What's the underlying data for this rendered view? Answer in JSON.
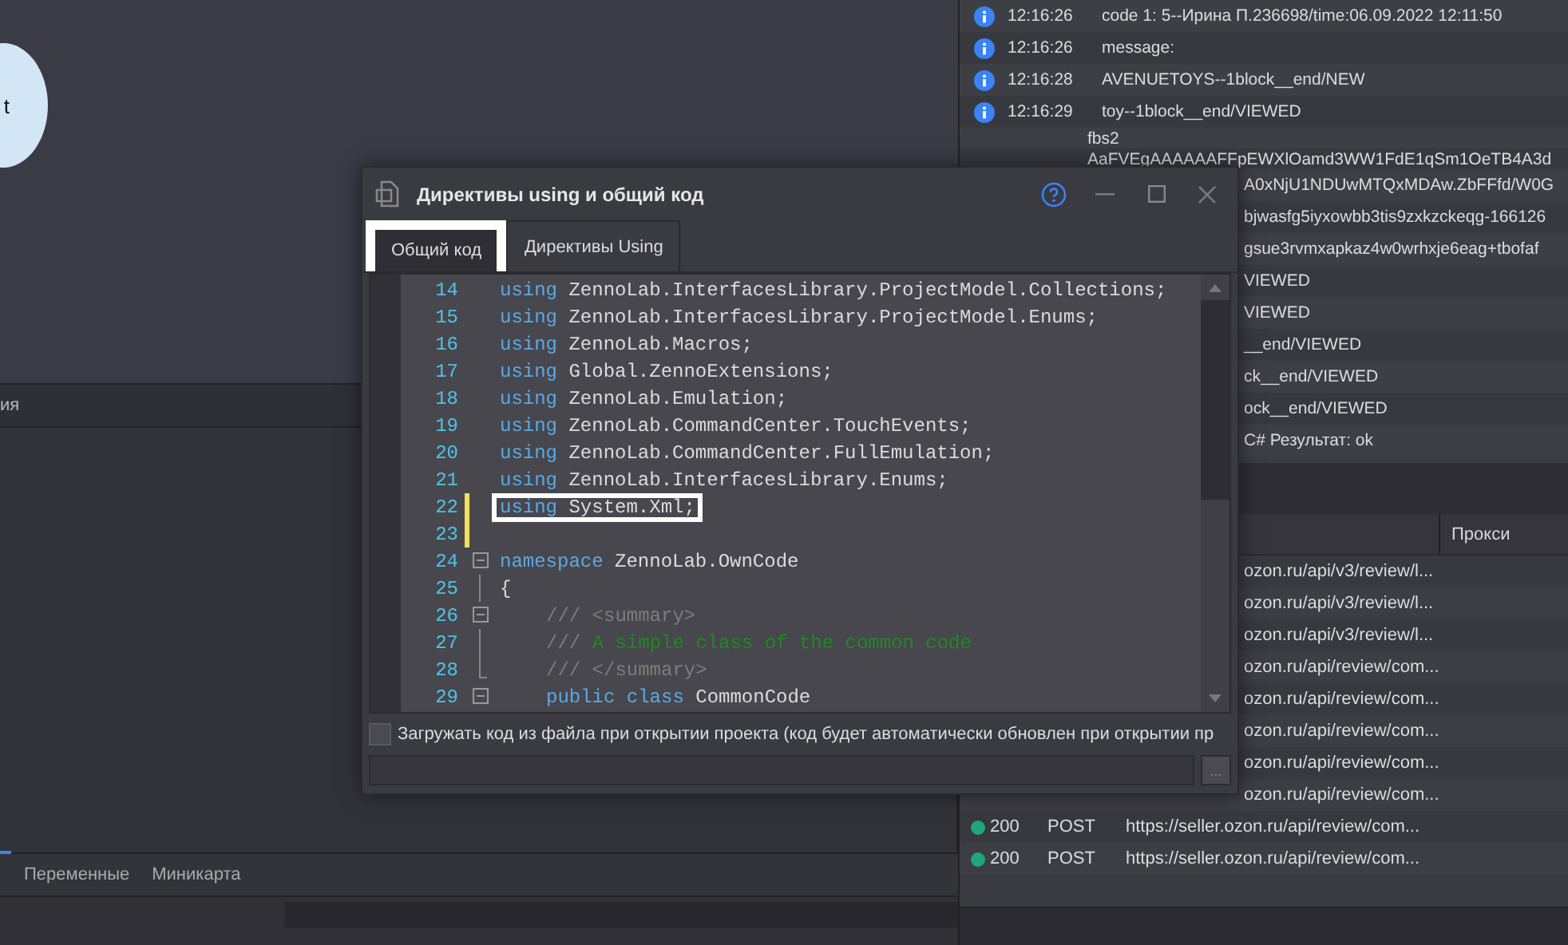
{
  "canvas": {
    "node_label": "t"
  },
  "bottom_panel": {
    "header_label": "ия",
    "tabs": [
      {
        "label": "Переменные",
        "selected": false
      },
      {
        "label": "Миникарта",
        "selected": false
      }
    ]
  },
  "log": [
    {
      "kind": "info",
      "time": "12:16:26",
      "message": "code 1: 5--Ирина П.236698/time:06.09.2022 12:11:50"
    },
    {
      "kind": "info",
      "time": "12:16:26",
      "message": "message:"
    },
    {
      "kind": "info",
      "time": "12:16:28",
      "message": "AVENUETOYS--1block__end/NEW"
    },
    {
      "kind": "info",
      "time": "12:16:29",
      "message": "toy--1block__end/VIEWED"
    },
    {
      "kind": "continuation",
      "message": "fbs2"
    },
    {
      "kind": "continuation",
      "message": "AaFVEgAAAAAAFFpEWXlOamd3WW1FdE1qSm1OeTB4A3d"
    },
    {
      "kind": "clipped",
      "message": "A0xNjU1NDUwMTQxMDAw.ZbFFfd/W0G"
    },
    {
      "kind": "clipped",
      "message": "bjwasfg5iyxowbb3tis9zxkzckeqg-166126"
    },
    {
      "kind": "clipped",
      "message": "gsue3rvmxapkaz4w0wrhxje6eag+tbofaf"
    },
    {
      "kind": "clipped",
      "message": "VIEWED"
    },
    {
      "kind": "clipped",
      "message": "VIEWED"
    },
    {
      "kind": "clipped",
      "message": "__end/VIEWED"
    },
    {
      "kind": "clipped",
      "message": "ck__end/VIEWED"
    },
    {
      "kind": "clipped",
      "message": "ock__end/VIEWED"
    },
    {
      "kind": "clipped",
      "message": "C# Результат: ok"
    }
  ],
  "requests": {
    "columns": [
      "Прокси"
    ],
    "rows": [
      {
        "kind": "clipped",
        "url": "ozon.ru/api/v3/review/l..."
      },
      {
        "kind": "clipped",
        "url": "ozon.ru/api/v3/review/l..."
      },
      {
        "kind": "clipped",
        "url": "ozon.ru/api/v3/review/l..."
      },
      {
        "kind": "clipped",
        "url": "ozon.ru/api/review/com..."
      },
      {
        "kind": "clipped",
        "url": "ozon.ru/api/review/com..."
      },
      {
        "kind": "clipped",
        "url": "ozon.ru/api/review/com..."
      },
      {
        "kind": "clipped",
        "url": "ozon.ru/api/review/com..."
      },
      {
        "kind": "clipped",
        "url": "ozon.ru/api/review/com..."
      },
      {
        "kind": "full",
        "color": "#1fa67a",
        "status": "200",
        "method": "POST",
        "url": "https://seller.ozon.ru/api/review/com..."
      },
      {
        "kind": "full",
        "color": "#1fa67a",
        "status": "200",
        "method": "POST",
        "url": "https://seller.ozon.ru/api/review/com..."
      }
    ]
  },
  "dialog": {
    "title": "Директивы using и общий код",
    "tabs": [
      {
        "label": "Общий код",
        "selected": true,
        "highlighted": true
      },
      {
        "label": "Директивы Using",
        "selected": false,
        "highlighted": false
      }
    ],
    "code_lines": [
      {
        "number": "14",
        "kind": "plain",
        "indented": false,
        "changed": false,
        "highlighted": false,
        "tokens": [
          {
            "kind": "keyword",
            "text": "using"
          },
          {
            "kind": "plain",
            "text": " ZennoLab.InterfacesLibrary.ProjectModel.Collections;"
          }
        ]
      },
      {
        "number": "15",
        "kind": "plain",
        "indented": false,
        "changed": false,
        "highlighted": false,
        "tokens": [
          {
            "kind": "keyword",
            "text": "using"
          },
          {
            "kind": "plain",
            "text": " ZennoLab.InterfacesLibrary.ProjectModel.Enums;"
          }
        ]
      },
      {
        "number": "16",
        "kind": "plain",
        "indented": false,
        "changed": false,
        "highlighted": false,
        "tokens": [
          {
            "kind": "keyword",
            "text": "using"
          },
          {
            "kind": "plain",
            "text": " ZennoLab.Macros;"
          }
        ]
      },
      {
        "number": "17",
        "kind": "plain",
        "indented": false,
        "changed": false,
        "highlighted": false,
        "tokens": [
          {
            "kind": "keyword",
            "text": "using"
          },
          {
            "kind": "plain",
            "text": " Global.ZennoExtensions;"
          }
        ]
      },
      {
        "number": "18",
        "kind": "plain",
        "indented": false,
        "changed": false,
        "highlighted": false,
        "tokens": [
          {
            "kind": "keyword",
            "text": "using"
          },
          {
            "kind": "plain",
            "text": " ZennoLab.Emulation;"
          }
        ]
      },
      {
        "number": "19",
        "kind": "plain",
        "indented": false,
        "changed": false,
        "highlighted": false,
        "tokens": [
          {
            "kind": "keyword",
            "text": "using"
          },
          {
            "kind": "plain",
            "text": " ZennoLab.CommandCenter.TouchEvents;"
          }
        ]
      },
      {
        "number": "20",
        "kind": "plain",
        "indented": false,
        "changed": false,
        "highlighted": false,
        "tokens": [
          {
            "kind": "keyword",
            "text": "using"
          },
          {
            "kind": "plain",
            "text": " ZennoLab.CommandCenter.FullEmulation;"
          }
        ]
      },
      {
        "number": "21",
        "kind": "plain",
        "indented": false,
        "changed": false,
        "highlighted": false,
        "tokens": [
          {
            "kind": "keyword",
            "text": "using"
          },
          {
            "kind": "plain",
            "text": " ZennoLab.InterfacesLibrary.Enums;"
          }
        ]
      },
      {
        "number": "22",
        "kind": "plain",
        "indented": false,
        "changed": true,
        "highlighted": true,
        "tokens": [
          {
            "kind": "keyword",
            "text": "using"
          },
          {
            "kind": "plain",
            "text": " System.Xml;"
          }
        ]
      },
      {
        "number": "23",
        "kind": "plain",
        "indented": false,
        "changed": true,
        "highlighted": false
      },
      {
        "number": "24",
        "kind": "fold-start",
        "indented": false,
        "changed": false,
        "highlighted": false,
        "tokens": [
          {
            "kind": "keyword",
            "text": "namespace"
          },
          {
            "kind": "plain",
            "text": " ZennoLab.OwnCode"
          }
        ]
      },
      {
        "number": "25",
        "kind": "fold-line",
        "indented": false,
        "changed": false,
        "highlighted": false,
        "tokens": [
          {
            "kind": "plain",
            "text": "{"
          }
        ]
      },
      {
        "number": "26",
        "kind": "fold-start",
        "indented": true,
        "changed": false,
        "highlighted": false,
        "tokens": [
          {
            "kind": "doc",
            "text": "/// <summary>"
          }
        ]
      },
      {
        "number": "27",
        "kind": "fold-line",
        "indented": true,
        "changed": false,
        "highlighted": false,
        "tokens": [
          {
            "kind": "doc",
            "text": "/// "
          },
          {
            "kind": "comment",
            "text": "A simple class of the common code"
          }
        ]
      },
      {
        "number": "28",
        "kind": "fold-end",
        "indented": true,
        "changed": false,
        "highlighted": false,
        "tokens": [
          {
            "kind": "doc",
            "text": "/// </summary>"
          }
        ]
      },
      {
        "number": "29",
        "kind": "fold-start",
        "indented": true,
        "changed": false,
        "highlighted": false,
        "tokens": [
          {
            "kind": "keyword",
            "text": "public class"
          },
          {
            "kind": "plain",
            "text": " CommonCode"
          }
        ]
      }
    ],
    "load_from_file": {
      "label": "Загружать код из файла при открытии проекта (код будет автоматически обновлен при открытии пр",
      "checked": false
    },
    "browse_button": "..."
  }
}
